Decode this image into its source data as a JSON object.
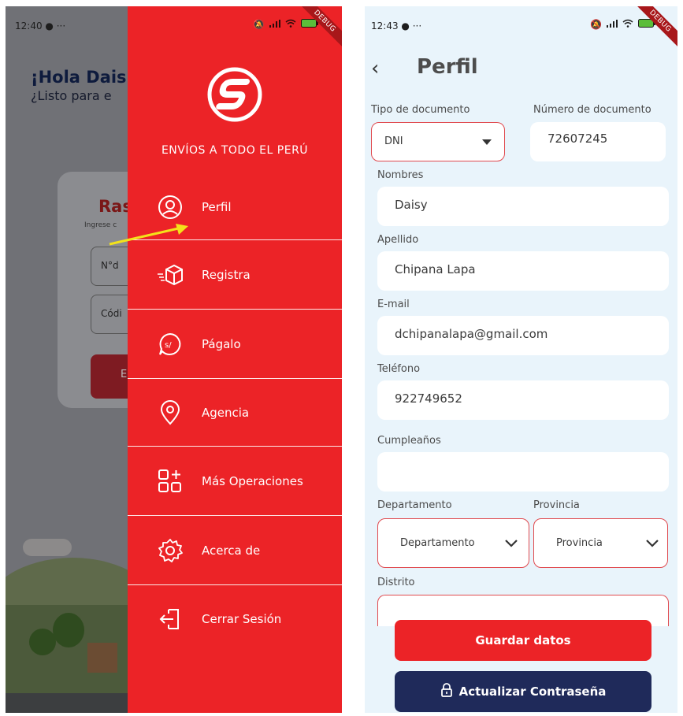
{
  "left_screen": {
    "status_time": "12:40",
    "status_extra": "···",
    "greeting": "¡Hola Dais",
    "subtitle": "¿Listo para e",
    "card_title": "Ras",
    "card_subtitle": "Ingrese c",
    "field_doc_placeholder": "N°d",
    "field_code_placeholder": "Códi",
    "card_button_label": "E",
    "drawer": {
      "debug_badge": "DEBUG",
      "slogan": "ENVÍOS A TODO EL PERÚ",
      "items": [
        {
          "label": "Perfil",
          "icon": "user-circle-icon"
        },
        {
          "label": "Registra",
          "icon": "package-icon"
        },
        {
          "label": "Págalo",
          "icon": "payment-icon"
        },
        {
          "label": "Agencia",
          "icon": "location-pin-icon"
        },
        {
          "label": "Más Operaciones",
          "icon": "grid-plus-icon"
        },
        {
          "label": "Acerca de",
          "icon": "gear-icon"
        },
        {
          "label": "Cerrar Sesión",
          "icon": "logout-icon"
        }
      ]
    }
  },
  "right_screen": {
    "status_time": "12:43",
    "status_extra": "···",
    "debug_badge": "DEBUG",
    "title": "Perfil",
    "form": {
      "tipo_documento_label": "Tipo de documento",
      "tipo_documento_value": "DNI",
      "numero_documento_label": "Número de documento",
      "numero_documento_value": "72607245",
      "nombres_label": "Nombres",
      "nombres_value": "Daisy",
      "apellido_label": "Apellido",
      "apellido_value": "Chipana Lapa",
      "email_label": "E-mail",
      "email_value": "dchipanalapa@gmail.com",
      "telefono_label": "Teléfono",
      "telefono_value": "922749652",
      "cumpleanos_label": "Cumpleaños",
      "cumpleanos_value": "",
      "departamento_label": "Departamento",
      "departamento_value": "Departamento",
      "provincia_label": "Provincia",
      "provincia_value": "Provincia",
      "distrito_label": "Distrito"
    },
    "buttons": {
      "save": "Guardar datos",
      "update_password": "Actualizar Contraseña"
    }
  },
  "colors": {
    "brand_red": "#ec2327",
    "navy": "#1f2a5a",
    "form_bg": "#e9f4fb"
  }
}
